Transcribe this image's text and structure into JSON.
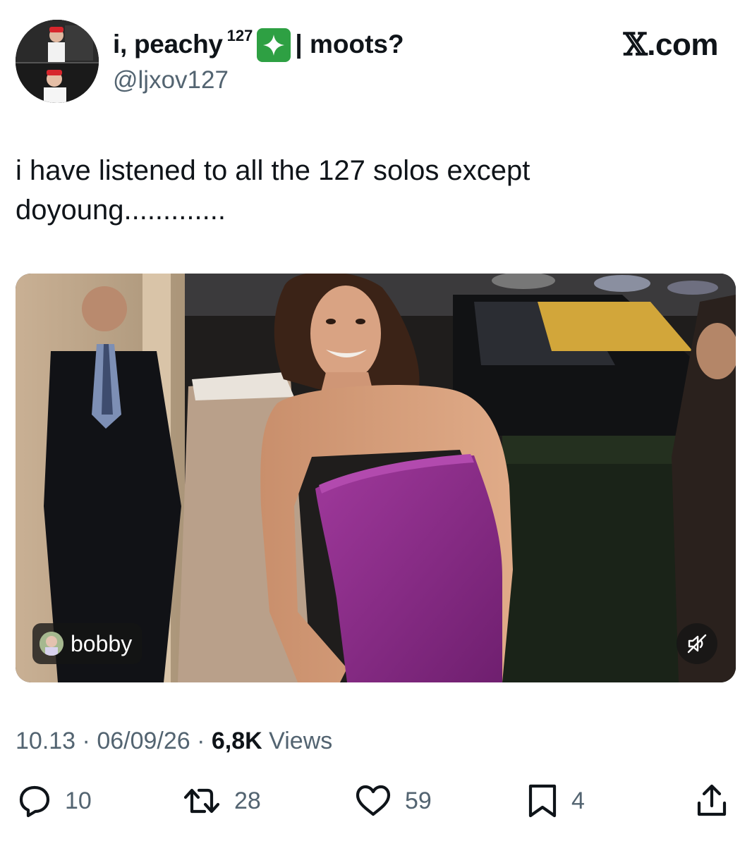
{
  "author": {
    "display_name": "i, peachy",
    "display_name_sup": "127",
    "display_name_suffix": "| moots?",
    "handle": "@ljxov127",
    "badge_color": "#2ea043"
  },
  "site": {
    "logo_glyph": "𝕏",
    "logo_text": ".com"
  },
  "tweet": {
    "text": "i have listened to all the 127 solos except\ndoyoung............."
  },
  "media": {
    "user_tag": "bobby",
    "mute_icon": "speaker-muted-icon",
    "dress_color": "#8f2e8e"
  },
  "meta": {
    "time": "10.13",
    "separator": " · ",
    "date": "06/09/26",
    "views_count": "6,8K",
    "views_label": "Views"
  },
  "actions": {
    "replies": "10",
    "reposts": "28",
    "likes": "59",
    "bookmarks": "4"
  }
}
